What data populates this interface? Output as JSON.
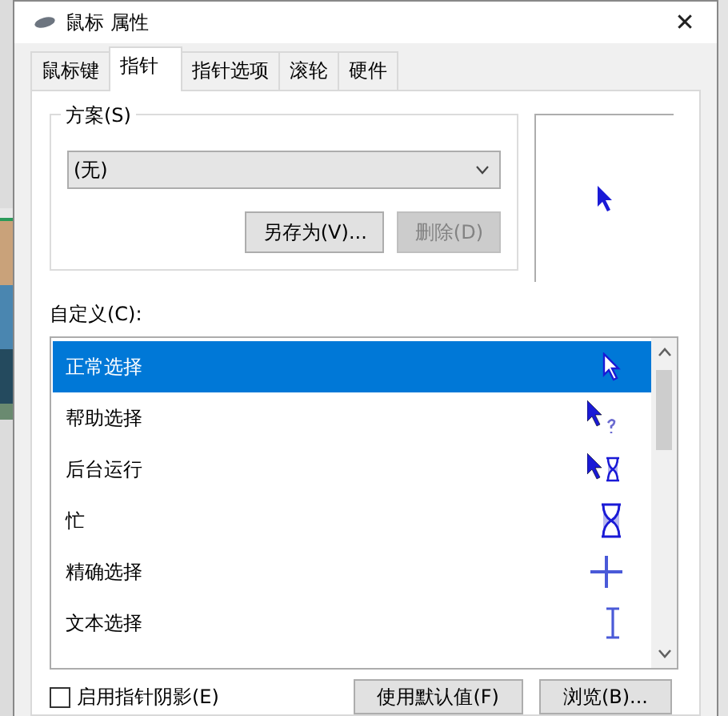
{
  "window": {
    "title": "鼠标 属性",
    "close": "✕"
  },
  "tabs": [
    {
      "label": "鼠标键",
      "selected": false
    },
    {
      "label": "指针",
      "selected": true
    },
    {
      "label": "指针选项",
      "selected": false
    },
    {
      "label": "滚轮",
      "selected": false
    },
    {
      "label": "硬件",
      "selected": false
    }
  ],
  "scheme": {
    "label": "方案(S)",
    "value": "(无)",
    "buttons": [
      {
        "label": "另存为(V)...",
        "disabled": false
      },
      {
        "label": "删除(D)",
        "disabled": true
      }
    ]
  },
  "customize": {
    "label": "自定义(C):",
    "items": [
      {
        "label": "正常选择",
        "selected": true
      },
      {
        "label": "帮助选择",
        "selected": false
      },
      {
        "label": "后台运行",
        "selected": false
      },
      {
        "label": "忙",
        "selected": false
      },
      {
        "label": "精确选择",
        "selected": false
      },
      {
        "label": "文本选择",
        "selected": false
      }
    ]
  },
  "shadow": {
    "label": "启用指针阴影(E)",
    "checked": false
  },
  "buttons": [
    {
      "label": "使用默认值(F)"
    },
    {
      "label": "浏览(B)..."
    }
  ]
}
